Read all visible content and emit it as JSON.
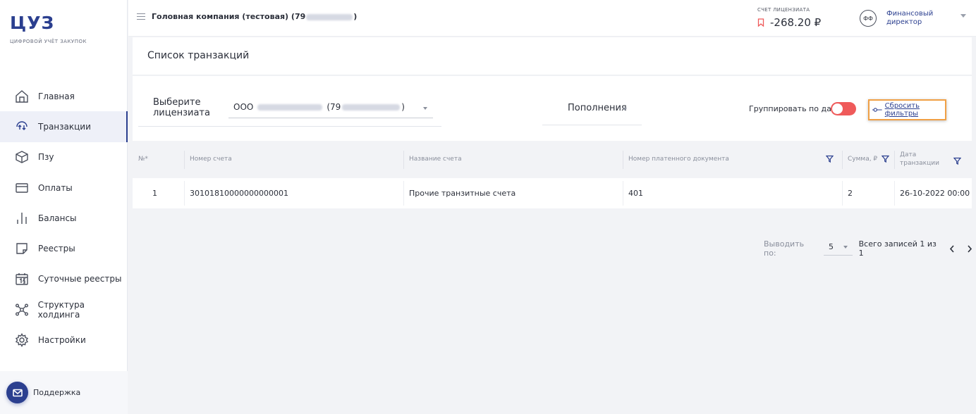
{
  "brand": {
    "logo": "ЦУЗ",
    "tagline": "ЦИФРОВОЙ УЧЁТ ЗАКУПОК"
  },
  "sidebar": {
    "items": [
      {
        "label": "Главная",
        "icon": "home-icon"
      },
      {
        "label": "Транзакции",
        "icon": "transactions-icon",
        "active": true
      },
      {
        "label": "Пзу",
        "icon": "box-icon"
      },
      {
        "label": "Оплаты",
        "icon": "card-icon"
      },
      {
        "label": "Балансы",
        "icon": "balance-bars-icon"
      },
      {
        "label": "Реестры",
        "icon": "registry-icon"
      },
      {
        "label": "Суточные реестры",
        "icon": "calendar-icon"
      },
      {
        "label": "Структура холдинга",
        "icon": "holding-structure-icon"
      },
      {
        "label": "Настройки",
        "icon": "gear-icon"
      }
    ],
    "support_label": "Поддержка"
  },
  "header": {
    "company_prefix": "Головная компания (тестовая) (79",
    "company_suffix": ")",
    "account_label": "СЧЕТ ЛИЦЕНЗИАТА",
    "account_value": "-268.20 ₽",
    "avatar_initials": "ФФ",
    "role": "Финансовый директор"
  },
  "page": {
    "title": "Список транзакций"
  },
  "filters": {
    "licensee_label": "Выберите лицензиата",
    "licensee_prefix": "ООО",
    "licensee_num_prefix": "(79",
    "licensee_suffix": ")",
    "type_value": "Пополнения",
    "group_by_date_label": "Группировать по дате",
    "reset_label": "Сбросить фильтры"
  },
  "table": {
    "columns": [
      "№*",
      "Номер счета",
      "Название счета",
      "Номер платенного документа",
      "Сумма, ₽",
      "Дата транзакции"
    ],
    "rows": [
      {
        "num": "1",
        "account_number": "30101810000000000001",
        "account_name": "Прочие транзитные счета",
        "document_number": "401",
        "amount": "2",
        "date": "26-10-2022 00:00"
      }
    ]
  },
  "pagination": {
    "per_page_label": "Выводить по:",
    "per_page_value": "5",
    "total_label": "Всего записей 1 из 1"
  },
  "colors": {
    "accent": "#2b3f8f",
    "toggle": "#ef5a5a",
    "highlight": "#f0a045",
    "bookmark": "#ef5a5a"
  }
}
